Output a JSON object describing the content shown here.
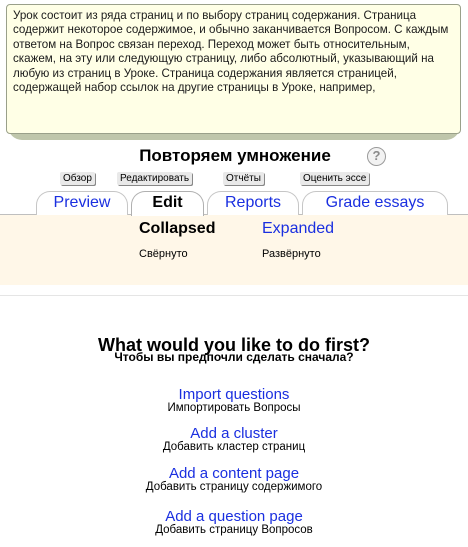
{
  "info_box": {
    "text": "Урок состоит из ряда страниц и по выбору страниц содержания. Страница содержит некоторое содержимое, и обычно заканчивается Вопросом. С каждым ответом на Вопрос связан переход. Переход может быть относительным, скажем, на эту или следующую страницу, либо абсолютный, указывающий на любую из страниц в Уроке. Страница содержания является страницей, содержащей набор ссылок на другие страницы в Уроке, например,"
  },
  "header": {
    "title": "Повторяем умножение",
    "help_icon": "?"
  },
  "tabs": {
    "ru": {
      "overview": "Обзор",
      "edit": "Редактировать",
      "reports": "Отчёты",
      "grade": "Оценить эссе"
    },
    "items": [
      {
        "label": "Preview"
      },
      {
        "label": "Edit"
      },
      {
        "label": "Reports"
      },
      {
        "label": "Grade essays"
      }
    ]
  },
  "subtabs": {
    "collapsed": "Collapsed",
    "expanded": "Expanded",
    "collapsed_ru": "Свёрнуто",
    "expanded_ru": "Развёрнуто"
  },
  "main": {
    "question": "What would you like to do first?",
    "question_ru": "Чтобы вы предпочли сделать сначала?",
    "actions": [
      {
        "label": "Import questions",
        "ru": "Импортировать Вопросы"
      },
      {
        "label": "Add a cluster",
        "ru": "Добавить кластер страниц"
      },
      {
        "label": "Add a content page",
        "ru": "Добавить страницу содержимого"
      },
      {
        "label": "Add a question page",
        "ru": "Добавить страницу Вопросов"
      }
    ]
  },
  "colors": {
    "link": "#1a2fe0",
    "info_bg": "#ffffe6",
    "subband_bg": "#fff7e8"
  }
}
